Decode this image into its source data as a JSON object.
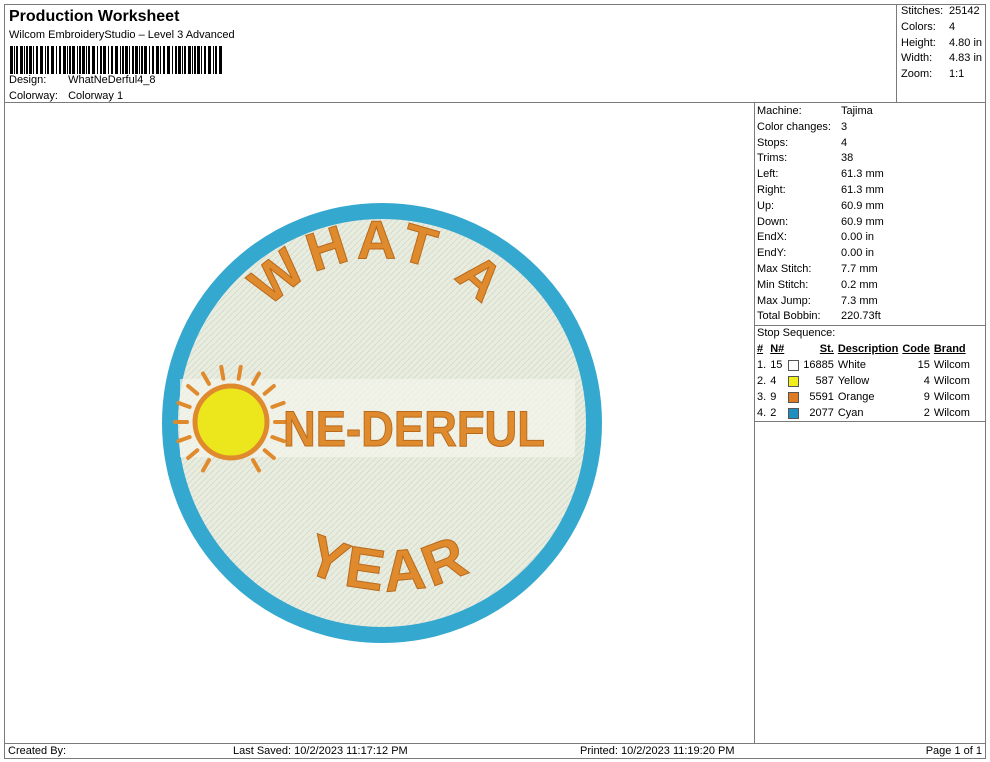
{
  "header": {
    "title": "Production Worksheet",
    "subtitle": "Wilcom EmbroideryStudio – Level 3 Advanced",
    "design_label": "Design:",
    "design_value": "WhatNeDerful4_8",
    "colorway_label": "Colorway:",
    "colorway_value": "Colorway 1"
  },
  "summary": {
    "stitches_label": "Stitches:",
    "stitches": "25142",
    "colors_label": "Colors:",
    "colors": "4",
    "height_label": "Height:",
    "height": "4.80 in",
    "width_label": "Width:",
    "width": "4.83 in",
    "zoom_label": "Zoom:",
    "zoom": "1:1"
  },
  "machine_info": [
    {
      "k": "Machine:",
      "v": "Tajima"
    },
    {
      "k": "Color changes:",
      "v": "3"
    },
    {
      "k": "Stops:",
      "v": "4"
    },
    {
      "k": "Trims:",
      "v": "38"
    },
    {
      "k": "Left:",
      "v": "61.3 mm"
    },
    {
      "k": "Right:",
      "v": "61.3 mm"
    },
    {
      "k": "Up:",
      "v": "60.9 mm"
    },
    {
      "k": "Down:",
      "v": "60.9 mm"
    },
    {
      "k": "EndX:",
      "v": "0.00 in"
    },
    {
      "k": "EndY:",
      "v": "0.00 in"
    },
    {
      "k": "Max Stitch:",
      "v": "7.7 mm"
    },
    {
      "k": "Min Stitch:",
      "v": "0.2 mm"
    },
    {
      "k": "Max Jump:",
      "v": "7.3 mm"
    },
    {
      "k": "Total Bobbin:",
      "v": "220.73ft"
    }
  ],
  "stop_sequence": {
    "title": "Stop Sequence:",
    "headers": [
      "#",
      "N#",
      "St.",
      "Description",
      "Code",
      "Brand"
    ],
    "rows": [
      {
        "idx": "1.",
        "n": "15",
        "color": "#ffffff",
        "st": "16885",
        "desc": "White",
        "code": "15",
        "brand": "Wilcom"
      },
      {
        "idx": "2.",
        "n": "4",
        "color": "#f2ee1a",
        "st": "587",
        "desc": "Yellow",
        "code": "4",
        "brand": "Wilcom"
      },
      {
        "idx": "3.",
        "n": "9",
        "color": "#e07a22",
        "st": "5591",
        "desc": "Orange",
        "code": "9",
        "brand": "Wilcom"
      },
      {
        "idx": "4.",
        "n": "2",
        "color": "#1e8fc0",
        "st": "2077",
        "desc": "Cyan",
        "code": "2",
        "brand": "Wilcom"
      }
    ]
  },
  "design": {
    "line1": "WHAT A",
    "line2": "NE-DERFUL",
    "line3": "YEAR",
    "colors": {
      "ring": "#35a8d0",
      "fill": "#e9ede0",
      "text": "#e08a2e",
      "sun": "#ece61c"
    }
  },
  "footer": {
    "created": "Created By:",
    "saved": "Last Saved: 10/2/2023 11:17:12 PM",
    "printed": "Printed: 10/2/2023 11:19:20 PM",
    "page": "Page 1 of 1"
  }
}
